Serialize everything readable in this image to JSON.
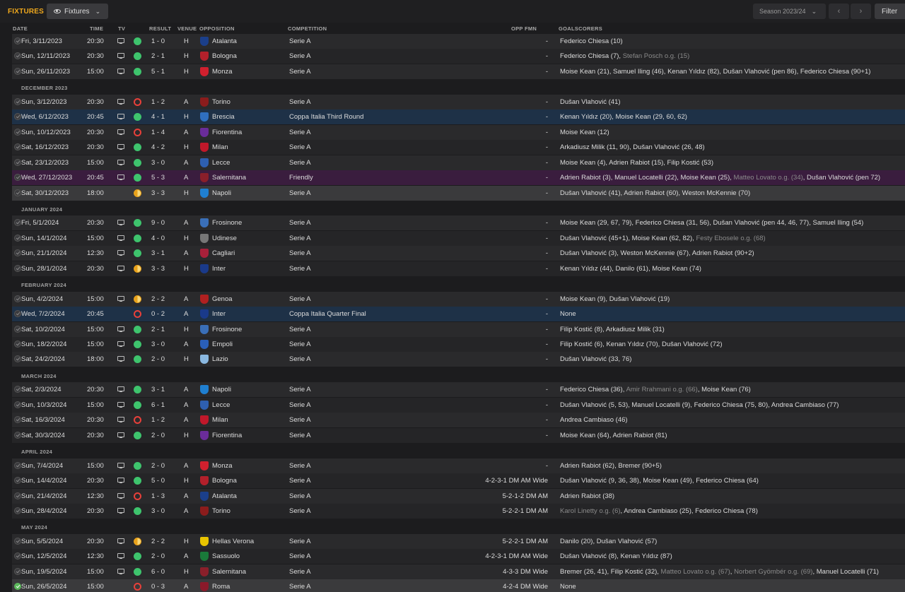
{
  "topbar": {
    "title": "FIXTURES",
    "view_label": "Fixtures",
    "season_label": "Season 2023/24",
    "prev_icon": "chevron-left-icon",
    "next_icon": "chevron-right-icon",
    "filter_label": "Filter"
  },
  "columns": {
    "date": "DATE",
    "time": "TIME",
    "tv": "TV",
    "result": "RESULT",
    "venue": "VENUE",
    "opposition": "OPPOSITION",
    "competition": "COMPETITION",
    "opp_fmn": "OPP FMN",
    "goalscorers": "GOALSCORERS"
  },
  "colors": {
    "accent": "#f0a81c",
    "win": "#3ec46d",
    "loss": "#e8403a",
    "draw": "#e9a21b",
    "cup_row": "#1e3147",
    "friendly_row": "#3a1d3e"
  },
  "rows": [
    {
      "type": "match",
      "date": "Fri, 3/11/2023",
      "time": "20:30",
      "tv": true,
      "outcome": "W",
      "result": "1 - 0",
      "venue": "H",
      "opp": "Atalanta",
      "crest": "#1b3f8a",
      "comp": "Serie A",
      "fmn": "-",
      "scorers": [
        {
          "t": "Federico Chiesa (10)"
        }
      ]
    },
    {
      "type": "match",
      "date": "Sun, 12/11/2023",
      "time": "20:30",
      "tv": true,
      "outcome": "W",
      "result": "2 - 1",
      "venue": "H",
      "opp": "Bologna",
      "crest": "#b3202b",
      "comp": "Serie A",
      "fmn": "-",
      "scorers": [
        {
          "t": "Federico Chiesa (7), "
        },
        {
          "t": "Stefan Posch o.g. (15)",
          "og": true
        }
      ]
    },
    {
      "type": "match",
      "date": "Sun, 26/11/2023",
      "time": "15:00",
      "tv": true,
      "outcome": "W",
      "result": "5 - 1",
      "venue": "H",
      "opp": "Monza",
      "crest": "#d0202e",
      "comp": "Serie A",
      "fmn": "-",
      "scorers": [
        {
          "t": "Moise Kean (21), Samuel Iling (46), Kenan Yıldız (82), Dušan Vlahović (pen 86), Federico Chiesa (90+1)"
        }
      ]
    },
    {
      "type": "section",
      "label": "DECEMBER 2023"
    },
    {
      "type": "match",
      "date": "Sun, 3/12/2023",
      "time": "20:30",
      "tv": true,
      "outcome": "L",
      "result": "1 - 2",
      "venue": "A",
      "opp": "Torino",
      "crest": "#8b1c1c",
      "comp": "Serie A",
      "fmn": "-",
      "scorers": [
        {
          "t": "Dušan Vlahović (41)"
        }
      ]
    },
    {
      "type": "match",
      "row_style": "cup",
      "date": "Wed, 6/12/2023",
      "time": "20:45",
      "tv": true,
      "outcome": "W",
      "result": "4 - 1",
      "venue": "H",
      "opp": "Brescia",
      "crest": "#2f6fc0",
      "comp": "Coppa Italia Third Round",
      "fmn": "-",
      "scorers": [
        {
          "t": "Kenan Yıldız (20), Moise Kean (29, 60, 62)"
        }
      ]
    },
    {
      "type": "match",
      "date": "Sun, 10/12/2023",
      "time": "20:30",
      "tv": true,
      "outcome": "L",
      "result": "1 - 4",
      "venue": "A",
      "opp": "Fiorentina",
      "crest": "#6a2c9a",
      "comp": "Serie A",
      "fmn": "-",
      "scorers": [
        {
          "t": "Moise Kean (12)"
        }
      ]
    },
    {
      "type": "match",
      "date": "Sat, 16/12/2023",
      "time": "20:30",
      "tv": true,
      "outcome": "W",
      "result": "4 - 2",
      "venue": "H",
      "opp": "Milan",
      "crest": "#c0182a",
      "comp": "Serie A",
      "fmn": "-",
      "scorers": [
        {
          "t": "Arkadiusz Milik (11, 90), Dušan Vlahović (26, 48)"
        }
      ]
    },
    {
      "type": "match",
      "date": "Sat, 23/12/2023",
      "time": "15:00",
      "tv": true,
      "outcome": "W",
      "result": "3 - 0",
      "venue": "A",
      "opp": "Lecce",
      "crest": "#2e5fb0",
      "comp": "Serie A",
      "fmn": "-",
      "scorers": [
        {
          "t": "Moise Kean (4), Adrien Rabiot (15), Filip Kostić (53)"
        }
      ]
    },
    {
      "type": "match",
      "row_style": "friendly",
      "date": "Wed, 27/12/2023",
      "time": "20:45",
      "tv": true,
      "outcome": "W",
      "result": "5 - 3",
      "venue": "A",
      "opp": "Salernitana",
      "crest": "#8a1f2a",
      "comp": "Friendly",
      "fmn": "-",
      "scorers": [
        {
          "t": "Adrien Rabiot (3), Manuel Locatelli (22), Moise Kean (25), "
        },
        {
          "t": "Matteo Lovato o.g. (34)",
          "og": true
        },
        {
          "t": ", Dušan Vlahović (pen 72)"
        }
      ]
    },
    {
      "type": "match",
      "row_style": "sel",
      "date": "Sat, 30/12/2023",
      "time": "18:00",
      "tv": false,
      "outcome": "D",
      "result": "3 - 3",
      "venue": "H",
      "opp": "Napoli",
      "crest": "#1f7fd0",
      "comp": "Serie A",
      "fmn": "-",
      "scorers": [
        {
          "t": "Dušan Vlahović (41), Adrien Rabiot (60), Weston McKennie (70)"
        }
      ]
    },
    {
      "type": "section",
      "label": "JANUARY 2024"
    },
    {
      "type": "match",
      "date": "Fri, 5/1/2024",
      "time": "20:30",
      "tv": true,
      "outcome": "W",
      "result": "9 - 0",
      "venue": "A",
      "opp": "Frosinone",
      "crest": "#3a6fb8",
      "comp": "Serie A",
      "fmn": "-",
      "scorers": [
        {
          "t": "Moise Kean (29, 67, 79), Federico Chiesa (31, 56), Dušan Vlahović (pen 44, 46, 77), Samuel Iling (54)"
        }
      ]
    },
    {
      "type": "match",
      "date": "Sun, 14/1/2024",
      "time": "15:00",
      "tv": true,
      "outcome": "W",
      "result": "4 - 0",
      "venue": "H",
      "opp": "Udinese",
      "crest": "#777777",
      "comp": "Serie A",
      "fmn": "-",
      "scorers": [
        {
          "t": "Dušan Vlahović (45+1), Moise Kean (62, 82), "
        },
        {
          "t": "Festy Ebosele o.g. (68)",
          "og": true
        }
      ]
    },
    {
      "type": "match",
      "date": "Sun, 21/1/2024",
      "time": "12:30",
      "tv": true,
      "outcome": "W",
      "result": "3 - 1",
      "venue": "A",
      "opp": "Cagliari",
      "crest": "#a8203a",
      "comp": "Serie A",
      "fmn": "-",
      "scorers": [
        {
          "t": "Dušan Vlahović (3), Weston McKennie (67), Adrien Rabiot (90+2)"
        }
      ]
    },
    {
      "type": "match",
      "date": "Sun, 28/1/2024",
      "time": "20:30",
      "tv": true,
      "outcome": "D",
      "result": "3 - 3",
      "venue": "H",
      "opp": "Inter",
      "crest": "#1a3a8a",
      "comp": "Serie A",
      "fmn": "-",
      "scorers": [
        {
          "t": "Kenan Yıldız (44), Danilo (61), Moise Kean (74)"
        }
      ]
    },
    {
      "type": "section",
      "label": "FEBRUARY 2024"
    },
    {
      "type": "match",
      "date": "Sun, 4/2/2024",
      "time": "15:00",
      "tv": true,
      "outcome": "D",
      "result": "2 - 2",
      "venue": "A",
      "opp": "Genoa",
      "crest": "#b02020",
      "comp": "Serie A",
      "fmn": "-",
      "scorers": [
        {
          "t": "Moise Kean (9), Dušan Vlahović (19)"
        }
      ]
    },
    {
      "type": "match",
      "row_style": "cup",
      "date": "Wed, 7/2/2024",
      "time": "20:45",
      "tv": false,
      "outcome": "L",
      "result": "0 - 2",
      "venue": "A",
      "opp": "Inter",
      "crest": "#1a3a8a",
      "comp": "Coppa Italia Quarter Final",
      "fmn": "-",
      "scorers": [
        {
          "t": "None"
        }
      ]
    },
    {
      "type": "match",
      "date": "Sat, 10/2/2024",
      "time": "15:00",
      "tv": true,
      "outcome": "W",
      "result": "2 - 1",
      "venue": "H",
      "opp": "Frosinone",
      "crest": "#3a6fb8",
      "comp": "Serie A",
      "fmn": "-",
      "scorers": [
        {
          "t": "Filip Kostić (8), Arkadiusz Milik (31)"
        }
      ]
    },
    {
      "type": "match",
      "date": "Sun, 18/2/2024",
      "time": "15:00",
      "tv": true,
      "outcome": "W",
      "result": "3 - 0",
      "venue": "A",
      "opp": "Empoli",
      "crest": "#2a5fb8",
      "comp": "Serie A",
      "fmn": "-",
      "scorers": [
        {
          "t": "Filip Kostić (6), Kenan Yıldız (70), Dušan Vlahović (72)"
        }
      ]
    },
    {
      "type": "match",
      "date": "Sat, 24/2/2024",
      "time": "18:00",
      "tv": true,
      "outcome": "W",
      "result": "2 - 0",
      "venue": "H",
      "opp": "Lazio",
      "crest": "#8ab8e0",
      "comp": "Serie A",
      "fmn": "-",
      "scorers": [
        {
          "t": "Dušan Vlahović (33, 76)"
        }
      ]
    },
    {
      "type": "section",
      "label": "MARCH 2024"
    },
    {
      "type": "match",
      "date": "Sat, 2/3/2024",
      "time": "20:30",
      "tv": true,
      "outcome": "W",
      "result": "3 - 1",
      "venue": "A",
      "opp": "Napoli",
      "crest": "#1f7fd0",
      "comp": "Serie A",
      "fmn": "-",
      "scorers": [
        {
          "t": "Federico Chiesa (36), "
        },
        {
          "t": "Amir Rrahmani o.g. (66)",
          "og": true
        },
        {
          "t": ", Moise Kean (76)"
        }
      ]
    },
    {
      "type": "match",
      "date": "Sun, 10/3/2024",
      "time": "15:00",
      "tv": true,
      "outcome": "W",
      "result": "6 - 1",
      "venue": "A",
      "opp": "Lecce",
      "crest": "#2e5fb0",
      "comp": "Serie A",
      "fmn": "-",
      "scorers": [
        {
          "t": "Dušan Vlahović (5, 53), Manuel Locatelli (9), Federico Chiesa (75, 80), Andrea Cambiaso (77)"
        }
      ]
    },
    {
      "type": "match",
      "date": "Sat, 16/3/2024",
      "time": "20:30",
      "tv": true,
      "outcome": "L",
      "result": "1 - 2",
      "venue": "A",
      "opp": "Milan",
      "crest": "#c0182a",
      "comp": "Serie A",
      "fmn": "-",
      "scorers": [
        {
          "t": "Andrea Cambiaso (46)"
        }
      ]
    },
    {
      "type": "match",
      "date": "Sat, 30/3/2024",
      "time": "20:30",
      "tv": true,
      "outcome": "W",
      "result": "2 - 0",
      "venue": "H",
      "opp": "Fiorentina",
      "crest": "#6a2c9a",
      "comp": "Serie A",
      "fmn": "-",
      "scorers": [
        {
          "t": "Moise Kean (64), Adrien Rabiot (81)"
        }
      ]
    },
    {
      "type": "section",
      "label": "APRIL 2024"
    },
    {
      "type": "match",
      "date": "Sun, 7/4/2024",
      "time": "15:00",
      "tv": true,
      "outcome": "W",
      "result": "2 - 0",
      "venue": "A",
      "opp": "Monza",
      "crest": "#d0202e",
      "comp": "Serie A",
      "fmn": "-",
      "scorers": [
        {
          "t": "Adrien Rabiot (62), Bremer (90+5)"
        }
      ]
    },
    {
      "type": "match",
      "date": "Sun, 14/4/2024",
      "time": "20:30",
      "tv": true,
      "outcome": "W",
      "result": "5 - 0",
      "venue": "H",
      "opp": "Bologna",
      "crest": "#b3202b",
      "comp": "Serie A",
      "fmn": "4-2-3-1 DM AM Wide",
      "scorers": [
        {
          "t": "Dušan Vlahović (9, 36, 38), Moise Kean (49), Federico Chiesa (64)"
        }
      ]
    },
    {
      "type": "match",
      "date": "Sun, 21/4/2024",
      "time": "12:30",
      "tv": true,
      "outcome": "L",
      "result": "1 - 3",
      "venue": "A",
      "opp": "Atalanta",
      "crest": "#1b3f8a",
      "comp": "Serie A",
      "fmn": "5-2-1-2 DM AM",
      "scorers": [
        {
          "t": "Adrien Rabiot (38)"
        }
      ]
    },
    {
      "type": "match",
      "date": "Sun, 28/4/2024",
      "time": "20:30",
      "tv": true,
      "outcome": "W",
      "result": "3 - 0",
      "venue": "A",
      "opp": "Torino",
      "crest": "#8b1c1c",
      "comp": "Serie A",
      "fmn": "5-2-2-1 DM AM",
      "scorers": [
        {
          "t": "Karol Linetty o.g. (6)",
          "og": true
        },
        {
          "t": ", Andrea Cambiaso (25), Federico Chiesa (78)"
        }
      ]
    },
    {
      "type": "section",
      "label": "MAY 2024"
    },
    {
      "type": "match",
      "date": "Sun, 5/5/2024",
      "time": "20:30",
      "tv": true,
      "outcome": "D",
      "result": "2 - 2",
      "venue": "H",
      "opp": "Hellas Verona",
      "crest": "#e8c400",
      "comp": "Serie A",
      "fmn": "5-2-2-1 DM AM",
      "scorers": [
        {
          "t": "Danilo (20), Dušan Vlahović (57)"
        }
      ]
    },
    {
      "type": "match",
      "date": "Sun, 12/5/2024",
      "time": "12:30",
      "tv": true,
      "outcome": "W",
      "result": "2 - 0",
      "venue": "A",
      "opp": "Sassuolo",
      "crest": "#1a7a3a",
      "comp": "Serie A",
      "fmn": "4-2-3-1 DM AM Wide",
      "scorers": [
        {
          "t": "Dušan Vlahović (8), Kenan Yıldız (87)"
        }
      ]
    },
    {
      "type": "match",
      "date": "Sun, 19/5/2024",
      "time": "15:00",
      "tv": true,
      "outcome": "W",
      "result": "6 - 0",
      "venue": "H",
      "opp": "Salernitana",
      "crest": "#8a1f2a",
      "comp": "Serie A",
      "fmn": "4-3-3 DM Wide",
      "scorers": [
        {
          "t": "Bremer (26, 41), Filip Kostić (32), "
        },
        {
          "t": "Matteo Lovato o.g. (67)",
          "og": true
        },
        {
          "t": ", "
        },
        {
          "t": "Norbert Gyömbér o.g. (69)",
          "og": true
        },
        {
          "t": ", Manuel Locatelli (71)"
        }
      ]
    },
    {
      "type": "match",
      "row_style": "sel",
      "done": true,
      "date": "Sun, 26/5/2024",
      "time": "15:00",
      "tv": false,
      "outcome": "L",
      "result": "0 - 3",
      "venue": "A",
      "opp": "Roma",
      "crest": "#8a1a2a",
      "comp": "Serie A",
      "fmn": "4-2-4 DM Wide",
      "scorers": [
        {
          "t": "None"
        }
      ]
    }
  ]
}
